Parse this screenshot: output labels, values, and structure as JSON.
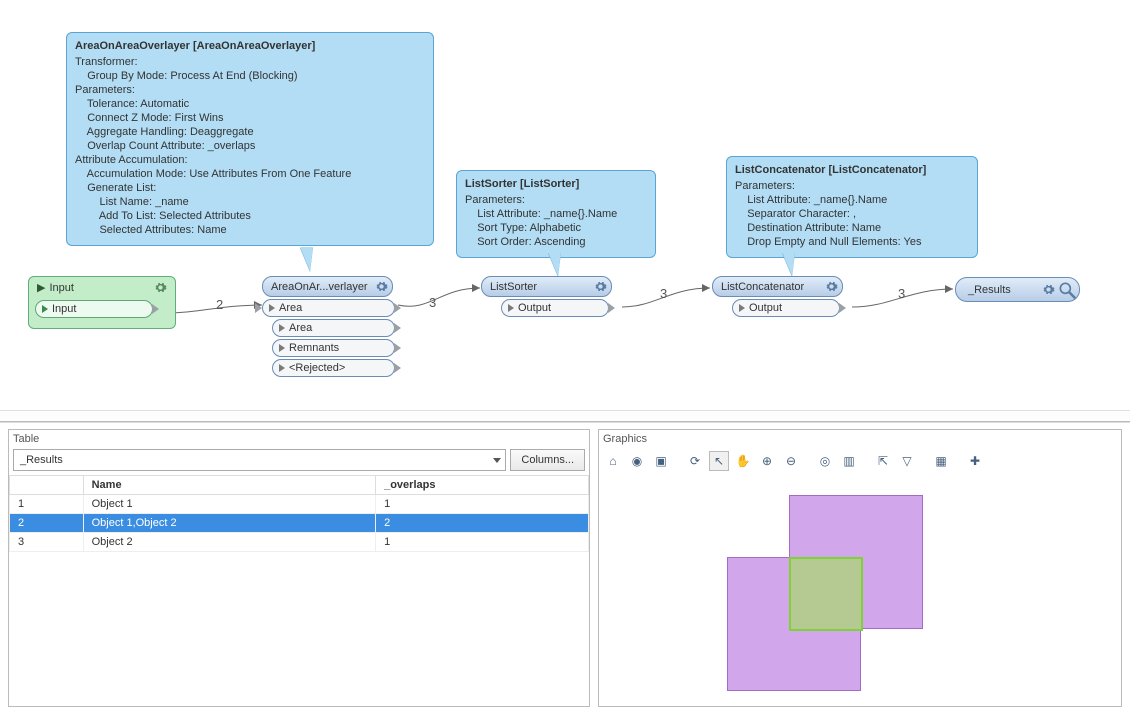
{
  "nodes": {
    "input_group": {
      "header": "Input",
      "port": "Input"
    },
    "aoa": {
      "header": "AreaOnAr...verlayer",
      "ports": [
        "Area",
        "Area",
        "Remnants",
        "<Rejected>"
      ]
    },
    "listsorter": {
      "header": "ListSorter",
      "ports": [
        "Output"
      ]
    },
    "listconcat": {
      "header": "ListConcatenator",
      "ports": [
        "Output"
      ]
    },
    "results": {
      "header": "_Results"
    }
  },
  "link_labels": {
    "a": "2",
    "b": "3",
    "c": "3",
    "d": "3"
  },
  "bubbles": {
    "aoa": {
      "title": "AreaOnAreaOverlayer [AreaOnAreaOverlayer]",
      "lines": [
        "Transformer:",
        "    Group By Mode: Process At End (Blocking)",
        "Parameters:",
        "    Tolerance: Automatic",
        "    Connect Z Mode: First Wins",
        "    Aggregate Handling: Deaggregate",
        "    Overlap Count Attribute: _overlaps",
        "Attribute Accumulation:",
        "    Accumulation Mode: Use Attributes From One Feature",
        "    Generate List:",
        "        List Name: _name",
        "        Add To List: Selected Attributes",
        "        Selected Attributes: Name"
      ]
    },
    "listsorter": {
      "title": "ListSorter [ListSorter]",
      "lines": [
        "Parameters:",
        "    List Attribute: _name{}.Name",
        "    Sort Type: Alphabetic",
        "    Sort Order: Ascending"
      ]
    },
    "listconcat": {
      "title": "ListConcatenator [ListConcatenator]",
      "lines": [
        "Parameters:",
        "    List Attribute: _name{}.Name",
        "    Separator Character: ,",
        "    Destination Attribute: Name",
        "    Drop Empty and Null Elements: Yes"
      ]
    }
  },
  "table_panel": {
    "title": "Table",
    "combo_value": "_Results",
    "columns_button": "Columns...",
    "headers": [
      "",
      "Name",
      "_overlaps"
    ],
    "rows": [
      {
        "n": "1",
        "name": "Object 1",
        "ov": "1",
        "selected": false
      },
      {
        "n": "2",
        "name": "Object 1,Object 2",
        "ov": "2",
        "selected": true
      },
      {
        "n": "3",
        "name": "Object 2",
        "ov": "1",
        "selected": false
      }
    ]
  },
  "graphics_panel": {
    "title": "Graphics",
    "icons": [
      "home-icon",
      "globe-icon",
      "camera-icon",
      "sep",
      "refresh-icon",
      "cursor-icon",
      "pan-icon",
      "zoom-in-icon",
      "zoom-out-icon",
      "sep",
      "zoom-selected-icon",
      "window-icon",
      "sep",
      "select-icon",
      "filter-icon",
      "sep",
      "grid-icon",
      "sep",
      "add-icon"
    ],
    "glyphs": {
      "home-icon": "⌂",
      "globe-icon": "◉",
      "camera-icon": "▣",
      "refresh-icon": "⟳",
      "cursor-icon": "↖",
      "pan-icon": "✋",
      "zoom-in-icon": "⊕",
      "zoom-out-icon": "⊖",
      "zoom-selected-icon": "◎",
      "window-icon": "▥",
      "select-icon": "⇱",
      "filter-icon": "▽",
      "grid-icon": "▦",
      "add-icon": "✚"
    }
  }
}
